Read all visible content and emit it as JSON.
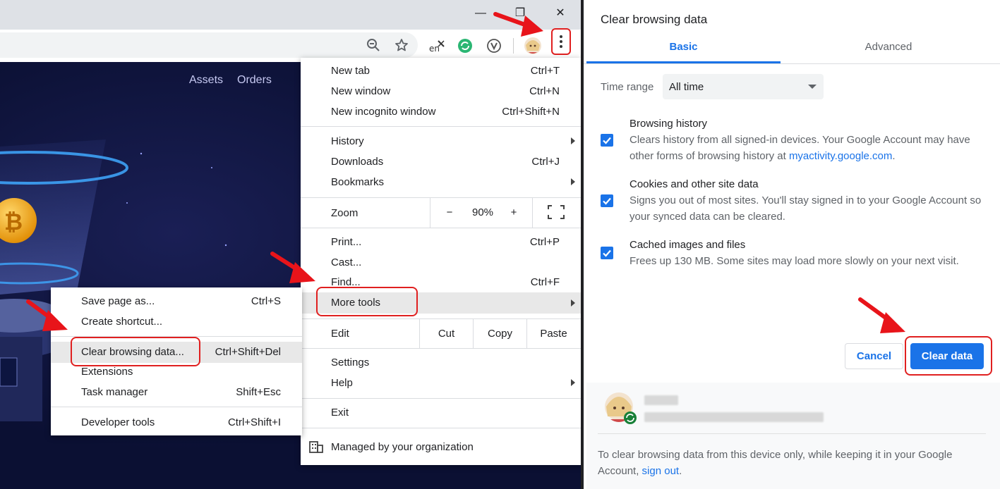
{
  "browser": {
    "window_controls": {
      "minimize": "—",
      "restore": "❐",
      "close": "✕"
    },
    "toolbar_icons": [
      "zoom-out-icon",
      "star-icon",
      "translate-icon",
      "sync-extension-icon",
      "v-extension-icon",
      "profile-avatar"
    ],
    "page_nav": {
      "assets": "Assets",
      "orders": "Orders"
    }
  },
  "main_menu": {
    "items": [
      {
        "label": "New tab",
        "shortcut": "Ctrl+T"
      },
      {
        "label": "New window",
        "shortcut": "Ctrl+N"
      },
      {
        "label": "New incognito window",
        "shortcut": "Ctrl+Shift+N"
      },
      {
        "label": "History",
        "shortcut": ""
      },
      {
        "label": "Downloads",
        "shortcut": "Ctrl+J"
      },
      {
        "label": "Bookmarks",
        "shortcut": ""
      },
      {
        "label": "Print...",
        "shortcut": "Ctrl+P"
      },
      {
        "label": "Cast...",
        "shortcut": ""
      },
      {
        "label": "Find...",
        "shortcut": "Ctrl+F"
      },
      {
        "label": "More tools",
        "shortcut": ""
      },
      {
        "label": "Settings",
        "shortcut": ""
      },
      {
        "label": "Help",
        "shortcut": ""
      },
      {
        "label": "Exit",
        "shortcut": ""
      }
    ],
    "zoom": {
      "label": "Zoom",
      "minus": "−",
      "value": "90%",
      "plus": "+"
    },
    "edit": {
      "label": "Edit",
      "cut": "Cut",
      "copy": "Copy",
      "paste": "Paste"
    },
    "managed": "Managed by your organization"
  },
  "sub_menu": {
    "items": [
      {
        "label": "Save page as...",
        "shortcut": "Ctrl+S"
      },
      {
        "label": "Create shortcut...",
        "shortcut": ""
      },
      {
        "label": "Clear browsing data...",
        "shortcut": "Ctrl+Shift+Del"
      },
      {
        "label": "Extensions",
        "shortcut": ""
      },
      {
        "label": "Task manager",
        "shortcut": "Shift+Esc"
      },
      {
        "label": "Developer tools",
        "shortcut": "Ctrl+Shift+I"
      }
    ]
  },
  "dialog": {
    "title": "Clear browsing data",
    "tabs": {
      "basic": "Basic",
      "advanced": "Advanced"
    },
    "time_range_label": "Time range",
    "time_range_value": "All time",
    "options": [
      {
        "title": "Browsing history",
        "desc": "Clears history from all signed-in devices. Your Google Account may have other forms of browsing history at ",
        "link": "myactivity.google.com",
        "desc_end": ".",
        "checked": true
      },
      {
        "title": "Cookies and other site data",
        "desc": "Signs you out of most sites. You'll stay signed in to your Google Account so your synced data can be cleared.",
        "checked": true
      },
      {
        "title": "Cached images and files",
        "desc": "Frees up 130 MB. Some sites may load more slowly on your next visit.",
        "checked": true
      }
    ],
    "cancel": "Cancel",
    "clear": "Clear data",
    "footer_text": "To clear browsing data from this device only, while keeping it in your Google Account, ",
    "footer_link": "sign out",
    "footer_end": ".",
    "accent": "#1a73e8"
  }
}
